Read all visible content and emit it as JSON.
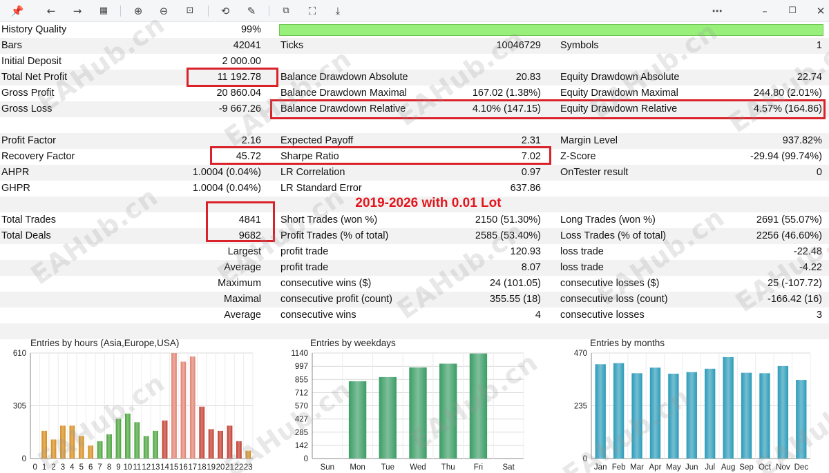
{
  "toolbar": {
    "icons": [
      "pin-icon",
      "back-arrow-icon",
      "forward-arrow-icon",
      "grid-icon",
      "zoom-in-icon",
      "zoom-out-icon",
      "fit-page-icon",
      "rotate-icon",
      "edit-icon",
      "copy-image-icon",
      "crop-icon",
      "save-icon",
      "more-icon",
      "minimize-icon",
      "maximize-icon",
      "close-icon"
    ]
  },
  "report": {
    "history_quality": {
      "label": "History Quality",
      "value": "99%",
      "bar_fill": 1.0
    },
    "bars": {
      "label": "Bars",
      "value": "42041"
    },
    "ticks": {
      "label": "Ticks",
      "value": "10046729"
    },
    "symbols": {
      "label": "Symbols",
      "value": "1"
    },
    "initial_deposit": {
      "label": "Initial Deposit",
      "value": "2 000.00"
    },
    "total_net_profit": {
      "label": "Total Net Profit",
      "value": "11 192.78"
    },
    "balance_dd_abs": {
      "label": "Balance Drawdown Absolute",
      "value": "20.83"
    },
    "equity_dd_abs": {
      "label": "Equity Drawdown Absolute",
      "value": "22.74"
    },
    "gross_profit": {
      "label": "Gross Profit",
      "value": "20 860.04"
    },
    "balance_dd_max": {
      "label": "Balance Drawdown Maximal",
      "value": "167.02 (1.38%)"
    },
    "equity_dd_max": {
      "label": "Equity Drawdown Maximal",
      "value": "244.80 (2.01%)"
    },
    "gross_loss": {
      "label": "Gross Loss",
      "value": "-9 667.26"
    },
    "balance_dd_rel": {
      "label": "Balance Drawdown Relative",
      "value": "4.10% (147.15)"
    },
    "equity_dd_rel": {
      "label": "Equity Drawdown Relative",
      "value": "4.57% (164.86)"
    },
    "profit_factor": {
      "label": "Profit Factor",
      "value": "2.16"
    },
    "expected_payoff": {
      "label": "Expected Payoff",
      "value": "2.31"
    },
    "margin_level": {
      "label": "Margin Level",
      "value": "937.82%"
    },
    "recovery_factor": {
      "label": "Recovery Factor",
      "value": "45.72"
    },
    "sharpe_ratio": {
      "label": "Sharpe Ratio",
      "value": "7.02"
    },
    "z_score": {
      "label": "Z-Score",
      "value": "-29.94 (99.74%)"
    },
    "ahpr": {
      "label": "AHPR",
      "value": "1.0004 (0.04%)"
    },
    "lr_correlation": {
      "label": "LR Correlation",
      "value": "0.97"
    },
    "ontester": {
      "label": "OnTester result",
      "value": "0"
    },
    "ghpr": {
      "label": "GHPR",
      "value": "1.0004 (0.04%)"
    },
    "lr_std_error": {
      "label": "LR Standard Error",
      "value": "637.86"
    },
    "banner": "2019-2026 with 0.01 Lot",
    "total_trades": {
      "label": "Total Trades",
      "value": "4841"
    },
    "short_trades": {
      "label": "Short Trades (won %)",
      "value": "2150 (51.30%)"
    },
    "long_trades": {
      "label": "Long Trades (won %)",
      "value": "2691 (55.07%)"
    },
    "total_deals": {
      "label": "Total Deals",
      "value": "9682"
    },
    "profit_trades": {
      "label": "Profit Trades (% of total)",
      "value": "2585 (53.40%)"
    },
    "loss_trades": {
      "label": "Loss Trades (% of total)",
      "value": "2256 (46.60%)"
    },
    "largest": {
      "label": "Largest",
      "profit_label": "profit trade",
      "profit": "120.93",
      "loss_label": "loss trade",
      "loss": "-22.48"
    },
    "average": {
      "label": "Average",
      "profit_label": "profit trade",
      "profit": "8.07",
      "loss_label": "loss trade",
      "loss": "-4.22"
    },
    "maximum": {
      "label": "Maximum",
      "profit_label": "consecutive wins ($)",
      "profit": "24 (101.05)",
      "loss_label": "consecutive losses ($)",
      "loss": "25 (-107.72)"
    },
    "maximal": {
      "label": "Maximal",
      "profit_label": "consecutive profit (count)",
      "profit": "355.55 (18)",
      "loss_label": "consecutive loss (count)",
      "loss": "-166.42 (16)"
    },
    "average2": {
      "label": "Average",
      "profit_label": "consecutive wins",
      "profit": "4",
      "loss_label": "consecutive losses",
      "loss": "3"
    }
  },
  "watermark": "EAHub.cn",
  "chart_data": [
    {
      "type": "bar",
      "title": "Entries by hours (Asia,Europe,USA)",
      "categories": [
        "0",
        "1",
        "2",
        "3",
        "4",
        "5",
        "6",
        "7",
        "8",
        "9",
        "10",
        "11",
        "12",
        "13",
        "14",
        "15",
        "16",
        "17",
        "18",
        "19",
        "20",
        "21",
        "22",
        "23"
      ],
      "values": [
        0,
        160,
        110,
        190,
        190,
        130,
        75,
        100,
        140,
        230,
        260,
        210,
        130,
        160,
        220,
        610,
        560,
        590,
        300,
        170,
        160,
        190,
        100,
        45
      ],
      "colors": [
        "#d58a1a",
        "#d58a1a",
        "#d58a1a",
        "#d58a1a",
        "#d58a1a",
        "#d58a1a",
        "#d58a1a",
        "#48a23a",
        "#48a23a",
        "#48a23a",
        "#48a23a",
        "#48a23a",
        "#48a23a",
        "#48a23a",
        "#c0392b",
        "#e0806e",
        "#e0806e",
        "#e0806e",
        "#c0392b",
        "#c0392b",
        "#c0392b",
        "#c0392b",
        "#c0392b",
        "#d58a1a"
      ],
      "yticks": [
        "0",
        "305",
        "610"
      ],
      "ylim": [
        0,
        610
      ]
    },
    {
      "type": "bar",
      "title": "Entries by weekdays",
      "categories": [
        "Sun",
        "Mon",
        "Tue",
        "Wed",
        "Thu",
        "Fri",
        "Sat"
      ],
      "values": [
        0,
        835,
        880,
        985,
        1025,
        1135,
        0
      ],
      "color": "#3a9d65",
      "yticks": [
        "0",
        "142",
        "285",
        "427",
        "570",
        "712",
        "855",
        "997",
        "1140"
      ],
      "ylim": [
        0,
        1140
      ]
    },
    {
      "type": "bar",
      "title": "Entries by months",
      "categories": [
        "Jan",
        "Feb",
        "Mar",
        "Apr",
        "May",
        "Jun",
        "Jul",
        "Aug",
        "Sep",
        "Oct",
        "Nov",
        "Dec"
      ],
      "values": [
        420,
        425,
        380,
        405,
        378,
        385,
        400,
        452,
        382,
        380,
        412,
        350
      ],
      "color": "#2a9bb8",
      "yticks": [
        "0",
        "235",
        "470"
      ],
      "ylim": [
        0,
        470
      ]
    }
  ]
}
